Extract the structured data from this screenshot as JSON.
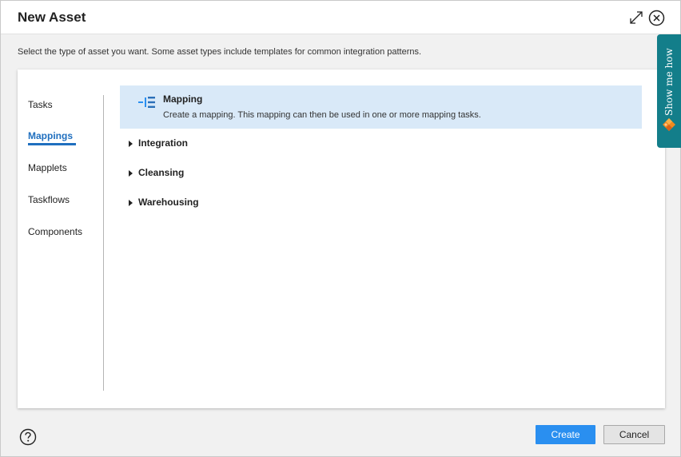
{
  "dialog": {
    "title": "New Asset",
    "subtitle": "Select the type of asset you want. Some asset types include templates for common integration patterns."
  },
  "nav": {
    "items": [
      {
        "label": "Tasks"
      },
      {
        "label": "Mappings"
      },
      {
        "label": "Mapplets"
      },
      {
        "label": "Taskflows"
      },
      {
        "label": "Components"
      }
    ],
    "active": "Mappings"
  },
  "main": {
    "selected": {
      "title": "Mapping",
      "description": "Create a mapping. This mapping can then be used in one or more mapping tasks.",
      "icon": "mapping-icon"
    },
    "groups": [
      {
        "label": "Integration"
      },
      {
        "label": "Cleansing"
      },
      {
        "label": "Warehousing"
      }
    ]
  },
  "footer": {
    "create_label": "Create",
    "cancel_label": "Cancel",
    "help_icon": "help-icon"
  },
  "side_tab": {
    "label": "Show me how",
    "logo": "informatica-logo-icon"
  },
  "colors": {
    "accent": "#1f6fbf",
    "primary_button": "#2a8ff0",
    "selected_row": "#d9e9f8",
    "side_tab": "#137e8a"
  }
}
